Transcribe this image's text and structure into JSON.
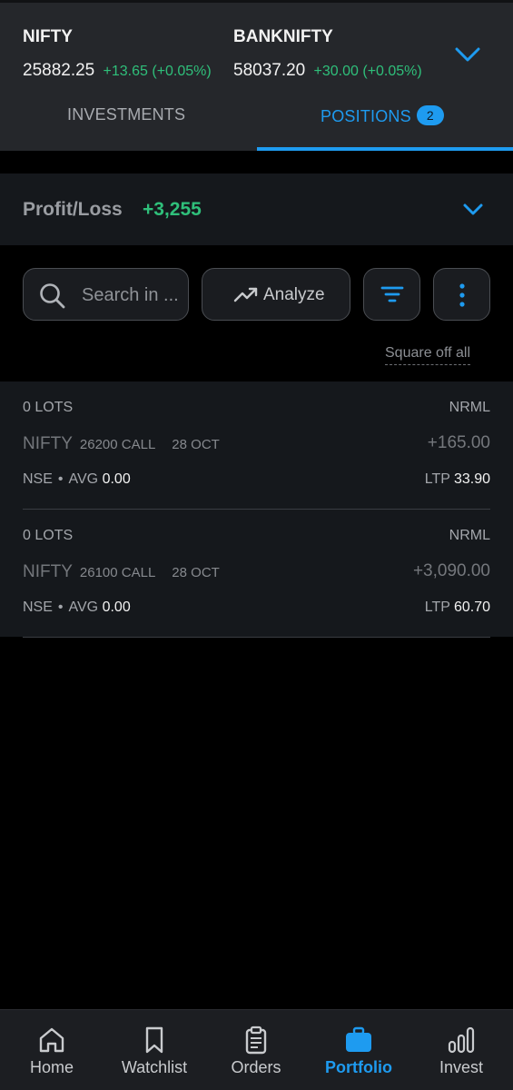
{
  "header": {
    "indices": [
      {
        "name": "NIFTY",
        "value": "25882.25",
        "change": "+13.65 (+0.05%)"
      },
      {
        "name": "BANKNIFTY",
        "value": "58037.20",
        "change": "+30.00 (+0.05%)"
      }
    ],
    "tabs": [
      {
        "label": "INVESTMENTS"
      },
      {
        "label": "POSITIONS",
        "badge": "2"
      }
    ]
  },
  "summary": {
    "label": "Profit/Loss",
    "value": "+3,255"
  },
  "toolbar": {
    "search_placeholder": "Search in ...",
    "analyze_label": "Analyze",
    "square_off_label": "Square off all"
  },
  "positions": [
    {
      "lots": "0 LOTS",
      "product": "NRML",
      "symbol": "NIFTY",
      "strike": "26200 CALL",
      "expiry": "28 OCT",
      "pnl": "+165.00",
      "exchange": "NSE",
      "avg_label": "AVG",
      "avg": "0.00",
      "ltp_label": "LTP",
      "ltp": "33.90"
    },
    {
      "lots": "0 LOTS",
      "product": "NRML",
      "symbol": "NIFTY",
      "strike": "26100 CALL",
      "expiry": "28 OCT",
      "pnl": "+3,090.00",
      "exchange": "NSE",
      "avg_label": "AVG",
      "avg": "0.00",
      "ltp_label": "LTP",
      "ltp": "60.70"
    }
  ],
  "bottom_nav": [
    {
      "label": "Home",
      "icon": "home-icon"
    },
    {
      "label": "Watchlist",
      "icon": "bookmark-icon"
    },
    {
      "label": "Orders",
      "icon": "clipboard-icon"
    },
    {
      "label": "Portfolio",
      "icon": "briefcase-icon",
      "active": true
    },
    {
      "label": "Invest",
      "icon": "bar-chart-icon"
    }
  ],
  "colors": {
    "accent": "#1e9bf0",
    "positive": "#2fbf7a",
    "background": "#000000",
    "card": "#15181c"
  }
}
